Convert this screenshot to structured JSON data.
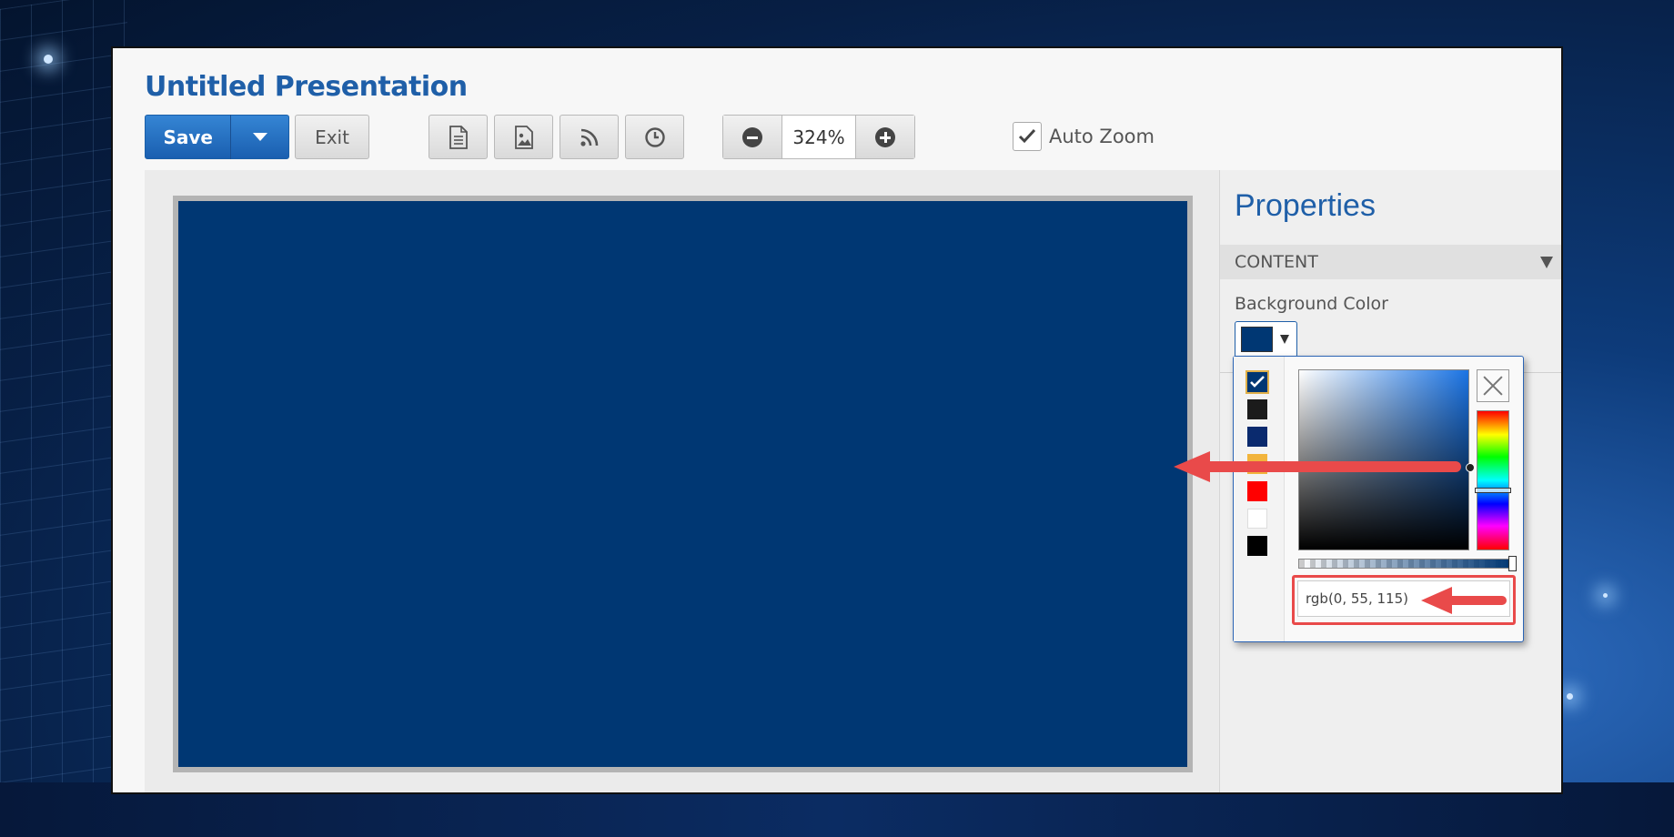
{
  "app": {
    "title": "Untitled Presentation"
  },
  "toolbar": {
    "save_label": "Save",
    "exit_label": "Exit",
    "icons": [
      "document-icon",
      "image-icon",
      "rss-icon",
      "clock-icon"
    ],
    "zoom_value": "324%",
    "auto_zoom_label": "Auto Zoom",
    "auto_zoom_checked": true
  },
  "canvas": {
    "background_color": "#003773"
  },
  "properties": {
    "title": "Properties",
    "section": "CONTENT",
    "background_color_label": "Background Color",
    "selected_color": "#003773"
  },
  "color_picker": {
    "palette": [
      "#003773",
      "#1b1b1b",
      "#0a2a6e",
      "#f2b43c",
      "#ff0000",
      "#ffffff",
      "#000000"
    ],
    "selected_index": 0,
    "hue_color": "#1b74e4",
    "value_text": "rgb(0, 55, 115)"
  },
  "colors": {
    "accent": "#1f5fa8",
    "annotation_arrow": "#e94a4a"
  }
}
